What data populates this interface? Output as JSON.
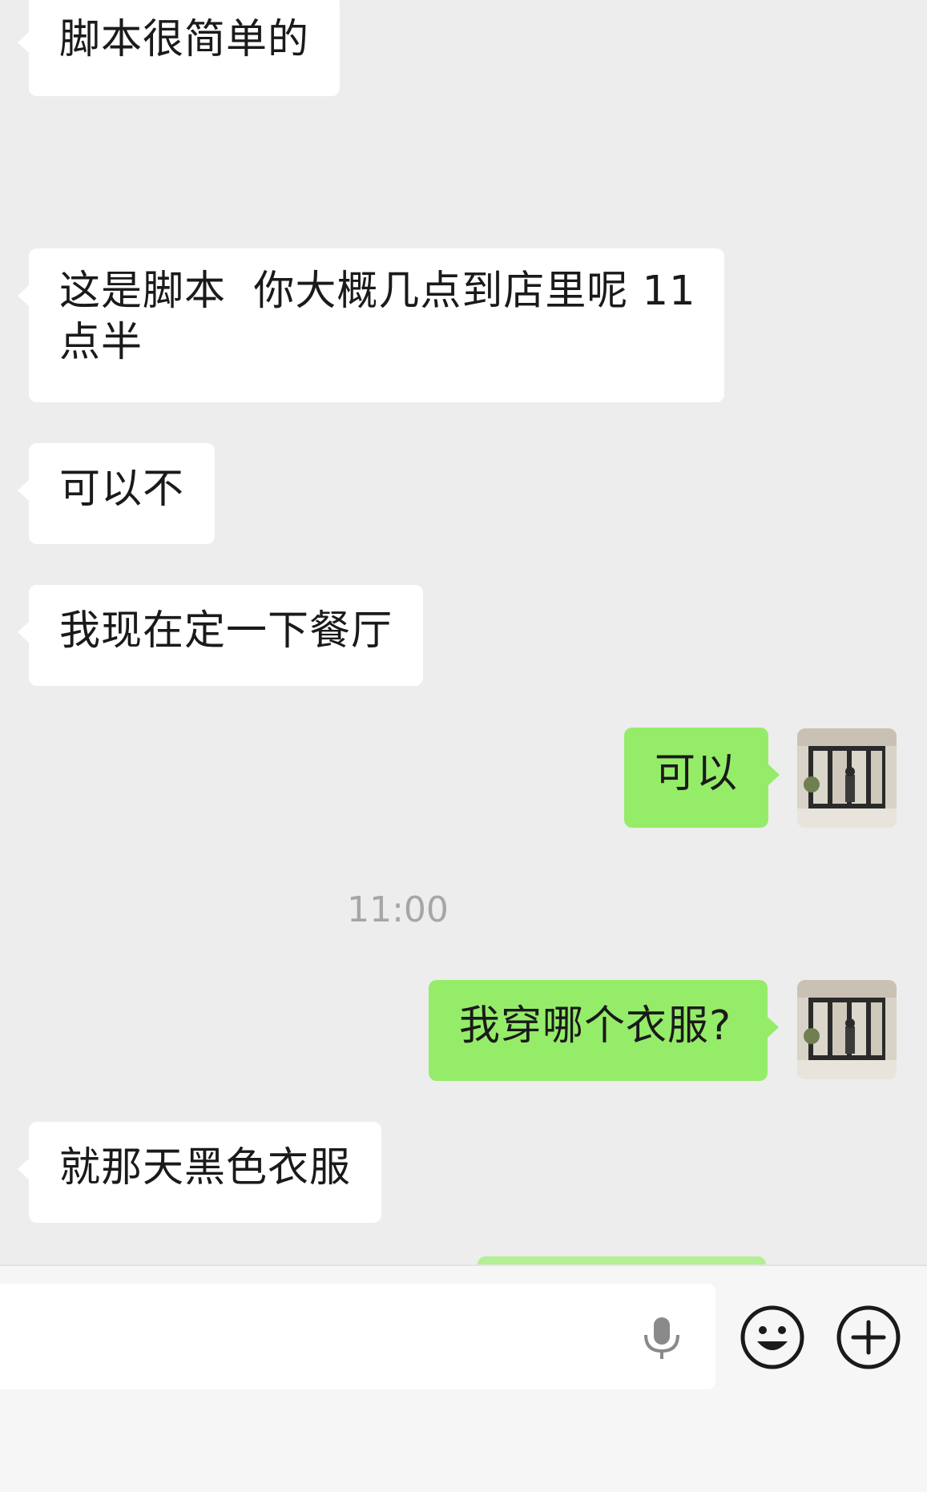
{
  "conversation": {
    "messages": [
      {
        "side": "in",
        "text": "脚本很简单的"
      },
      {
        "side": "in",
        "line1": "这是脚本  你大概几点到店里呢 11",
        "line2": "点半"
      },
      {
        "side": "in",
        "text": "可以不"
      },
      {
        "side": "in",
        "text": "我现在定一下餐厅"
      },
      {
        "side": "out",
        "text": "可以"
      },
      {
        "side": "out",
        "text": "我穿哪个衣服?"
      },
      {
        "side": "in",
        "text": "就那天黑色衣服"
      }
    ],
    "timestamp": "11:00"
  },
  "input_bar": {
    "icons": [
      "microphone-icon",
      "emoji-icon",
      "plus-icon"
    ]
  },
  "colors": {
    "background": "#ededed",
    "incoming_bubble": "#ffffff",
    "outgoing_bubble": "#95ec69",
    "timestamp_text": "#a6a6a6",
    "icon": "#1a1a1a"
  }
}
